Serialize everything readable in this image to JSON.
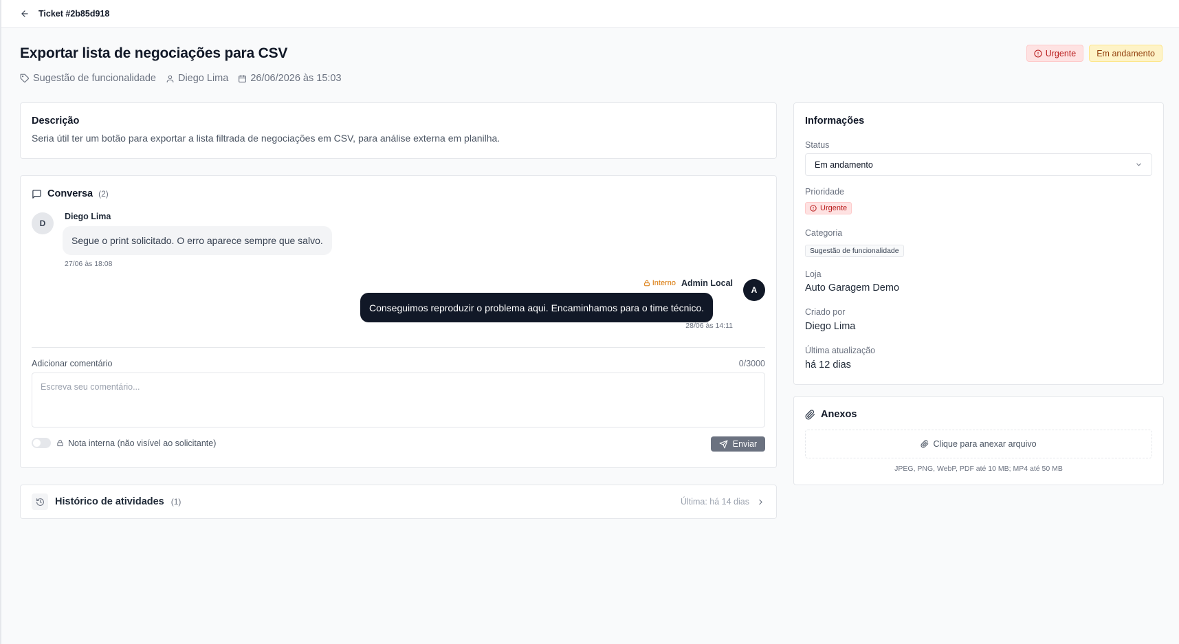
{
  "header": {
    "title": "Ticket #2b85d918"
  },
  "ticket": {
    "title": "Exportar lista de negociações para CSV",
    "badges": {
      "priority": "Urgente",
      "status": "Em andamento"
    },
    "meta": {
      "category": "Sugestão de funcionalidade",
      "author": "Diego Lima",
      "created": "26/06/2026 às 15:03"
    }
  },
  "description": {
    "title": "Descrição",
    "text": "Seria útil ter um botão para exportar a lista filtrada de negociações em CSV, para análise externa em planilha."
  },
  "conversation": {
    "title": "Conversa",
    "count": "(2)",
    "messages": [
      {
        "initial": "D",
        "author": "Diego Lima",
        "text": "Segue o print solicitado. O erro aparece sempre que salvo.",
        "time": "27/06 às 18:08"
      },
      {
        "initial": "A",
        "author": "Admin Local",
        "tag": "Interno",
        "text": "Conseguimos reproduzir o problema aqui. Encaminhamos para o time técnico.",
        "time": "28/06 às 14:11"
      }
    ],
    "add_label": "Adicionar comentário",
    "char_count": "0/3000",
    "placeholder": "Escreva seu comentário...",
    "internal_note": "Nota interna (não visível ao solicitante)",
    "send_label": "Enviar"
  },
  "history": {
    "title": "Histórico de atividades",
    "count": "(1)",
    "last": "Última: há 14 dias"
  },
  "info": {
    "title": "Informações",
    "status_label": "Status",
    "status_value": "Em andamento",
    "priority_label": "Prioridade",
    "priority_value": "Urgente",
    "category_label": "Categoria",
    "category_value": "Sugestão de funcionalidade",
    "store_label": "Loja",
    "store_value": "Auto Garagem Demo",
    "created_by_label": "Criado por",
    "created_by_value": "Diego Lima",
    "updated_label": "Última atualização",
    "updated_value": "há 12 dias"
  },
  "attachments": {
    "title": "Anexos",
    "drop_label": "Clique para anexar arquivo",
    "hint": "JPEG, PNG, WebP, PDF até 10 MB; MP4 até 50 MB"
  },
  "colors": {
    "urgent": "#b91c1c",
    "in_progress": "#92400e",
    "internal": "#d97706",
    "admin_bubble": "#111827"
  }
}
